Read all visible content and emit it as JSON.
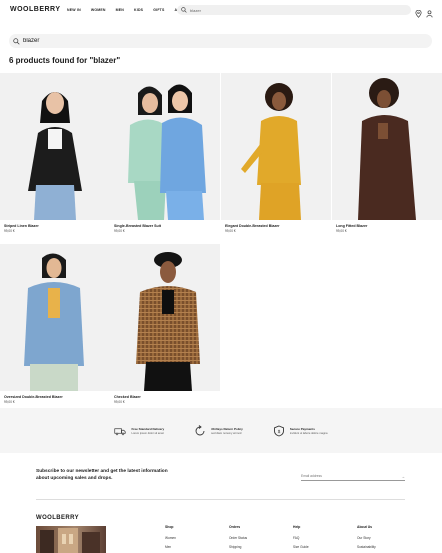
{
  "header": {
    "logo": "WOOLBERRY",
    "nav": [
      "NEW IN",
      "WOMEN",
      "MEN",
      "KIDS",
      "GIFTS",
      "ABOUT"
    ],
    "search_value": "blazer",
    "icons": [
      "search-icon",
      "location-pin-icon",
      "user-icon"
    ]
  },
  "search": {
    "value": "blazer"
  },
  "results_title": "6 products found for \"blazer\"",
  "products": [
    {
      "name": "Striped Linen Blazer",
      "price": "99,00 €"
    },
    {
      "name": "Single-Breasted Blazer Suit",
      "price": "99,00 €"
    },
    {
      "name": "Elegant Double-Breasted Blazer",
      "price": "99,00 €"
    },
    {
      "name": "Long Fitted Blazer",
      "price": "99,00 €"
    },
    {
      "name": "Oversized Double-Breasted Blazer",
      "price": "99,00 €"
    },
    {
      "name": "Checked Blazer",
      "price": "99,00 €"
    }
  ],
  "features": [
    {
      "title": "Free Standard Delivery",
      "subtitle": "Lorem ipsum dolor sit amet",
      "icon": "truck-icon"
    },
    {
      "title": "30-Days Return Policy",
      "subtitle": "sed diam nonumy eirmod",
      "icon": "return-icon"
    },
    {
      "title": "Secure Payments",
      "subtitle": "invidunt ut labore dolore magna",
      "icon": "shield-icon"
    }
  ],
  "newsletter": {
    "text": "Subscribe to our newsletter and get the latest information about upcoming sales and drops.",
    "placeholder": "Email address"
  },
  "footer": {
    "logo": "WOOLBERRY",
    "columns": [
      {
        "heading": "Shop",
        "links": [
          "Women",
          "Men"
        ]
      },
      {
        "heading": "Orders",
        "links": [
          "Order Status",
          "Shipping"
        ]
      },
      {
        "heading": "Help",
        "links": [
          "FAQ",
          "Size Guide"
        ]
      },
      {
        "heading": "About Us",
        "links": [
          "Our Story",
          "Sustainability"
        ]
      }
    ]
  },
  "colors": {
    "accent": "#1a1a1a",
    "band": "#f5f5f5",
    "search_bg": "#f0f0f0"
  }
}
